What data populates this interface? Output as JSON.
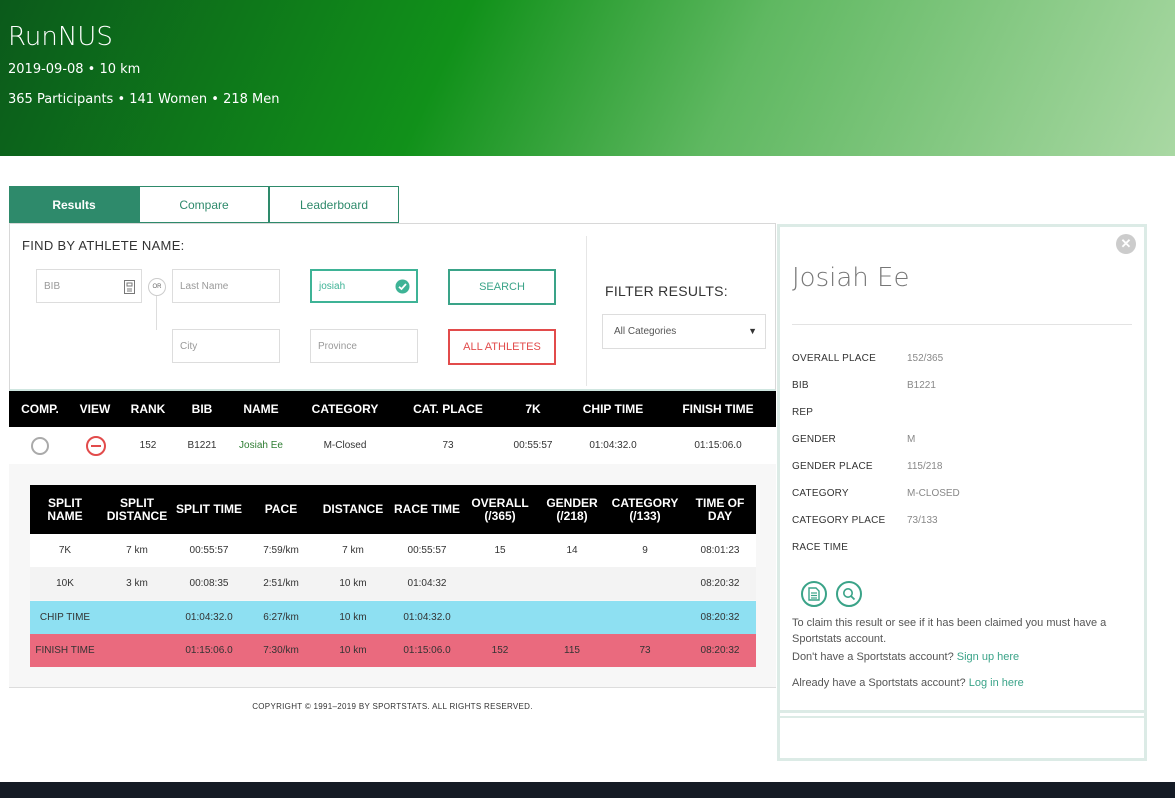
{
  "event": {
    "title": "RunNUS",
    "date_distance": "2019-09-08 • 10 km",
    "participants": "365 Participants • 141 Women • 218 Men"
  },
  "tabs": [
    "Results",
    "Compare",
    "Leaderboard"
  ],
  "search": {
    "heading": "FIND BY ATHLETE NAME:",
    "bib_placeholder": "BIB",
    "or_label": "OR",
    "last_name_placeholder": "Last Name",
    "first_name_value": "josiah",
    "city_placeholder": "City",
    "province_placeholder": "Province",
    "search_button": "SEARCH",
    "all_athletes_button": "ALL ATHLETES",
    "filter_heading": "FILTER RESULTS:",
    "filter_selected": "All Categories"
  },
  "results": {
    "columns": [
      "COMP.",
      "VIEW",
      "RANK",
      "BIB",
      "NAME",
      "CATEGORY",
      "CAT. PLACE",
      "7K",
      "CHIP TIME",
      "FINISH TIME"
    ],
    "row": {
      "rank": "152",
      "bib": "B1221",
      "name": "Josiah Ee",
      "category": "M-Closed",
      "cat_place": "73",
      "split_7k": "00:55:57",
      "chip_time": "01:04:32.0",
      "finish_time": "01:15:06.0"
    }
  },
  "splits": {
    "columns": [
      "SPLIT NAME",
      "SPLIT DISTANCE",
      "SPLIT TIME",
      "PACE",
      "DISTANCE",
      "RACE TIME",
      "OVERALL (/365)",
      "GENDER (/218)",
      "CATEGORY (/133)",
      "TIME OF DAY"
    ],
    "rows": [
      [
        "7K",
        "7 km",
        "00:55:57",
        "7:59/km",
        "7 km",
        "00:55:57",
        "15",
        "14",
        "9",
        "08:01:23"
      ],
      [
        "10K",
        "3 km",
        "00:08:35",
        "2:51/km",
        "10 km",
        "01:04:32",
        "",
        "",
        "",
        "08:20:32"
      ],
      [
        "CHIP TIME",
        "",
        "01:04:32.0",
        "6:27/km",
        "10 km",
        "01:04:32.0",
        "",
        "",
        "",
        "08:20:32"
      ],
      [
        "FINISH TIME",
        "",
        "01:15:06.0",
        "7:30/km",
        "10 km",
        "01:15:06.0",
        "152",
        "115",
        "73",
        "08:20:32"
      ]
    ],
    "row_colors": {
      "chip_time": "#8ee0f2",
      "finish_time": "#ea6a7e"
    }
  },
  "copyright": "COPYRIGHT © 1991–2019 BY SPORTSTATS. ALL RIGHTS RESERVED.",
  "athlete_panel": {
    "name": "Josiah Ee",
    "info": [
      {
        "label": "OVERALL PLACE",
        "value": "152/365"
      },
      {
        "label": "BIB",
        "value": "B1221"
      },
      {
        "label": "REP",
        "value": ""
      },
      {
        "label": "GENDER",
        "value": "M"
      },
      {
        "label": "GENDER PLACE",
        "value": "115/218"
      },
      {
        "label": "CATEGORY",
        "value": "M-CLOSED"
      },
      {
        "label": "CATEGORY PLACE",
        "value": "73/133"
      },
      {
        "label": "RACE TIME",
        "value": ""
      }
    ],
    "claim_text": "To claim this result or see if it has been claimed you must have a Sportstats account.",
    "no_account_text": "Don't have a Sportstats account?",
    "sign_up_link": "Sign up here",
    "have_account_text": "Already have a Sportstats account?",
    "log_in_link": "Log in here"
  },
  "icons": {
    "document": "document-icon",
    "search": "magnifier-icon",
    "close": "close-icon",
    "bib_card": "bib-card-icon",
    "check": "check-icon"
  },
  "colors": {
    "accent": "#3aa388",
    "tab_active": "#2e8a6b",
    "danger": "#e24b4b"
  }
}
